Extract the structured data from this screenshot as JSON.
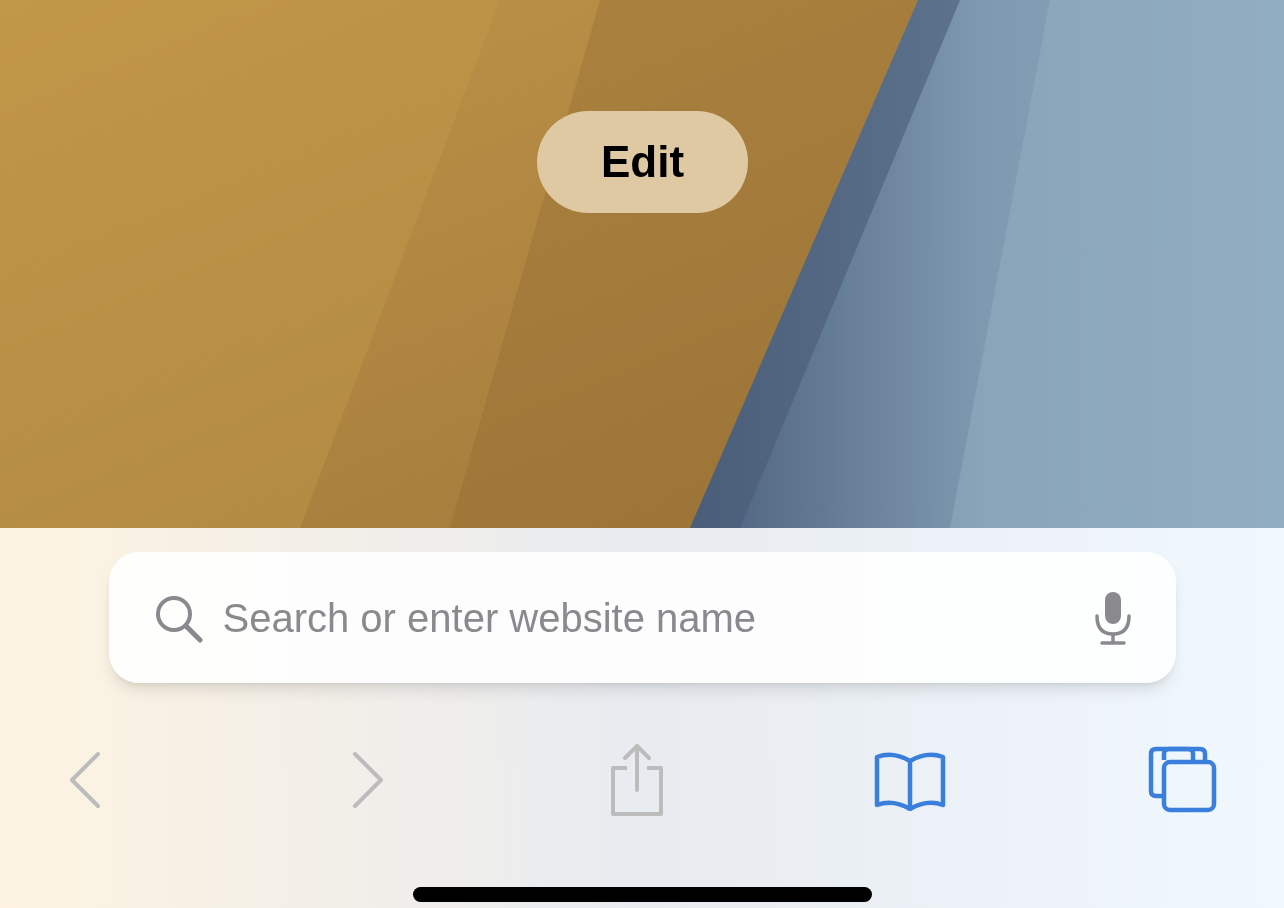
{
  "edit_button": {
    "label": "Edit"
  },
  "search": {
    "placeholder": "Search or enter website name"
  },
  "toolbar": [
    {
      "kind": "back",
      "disabled": true
    },
    {
      "kind": "forward",
      "disabled": true
    },
    {
      "kind": "share",
      "disabled": true
    },
    {
      "kind": "bookmarks",
      "disabled": false
    },
    {
      "kind": "tabs",
      "disabled": false
    }
  ]
}
